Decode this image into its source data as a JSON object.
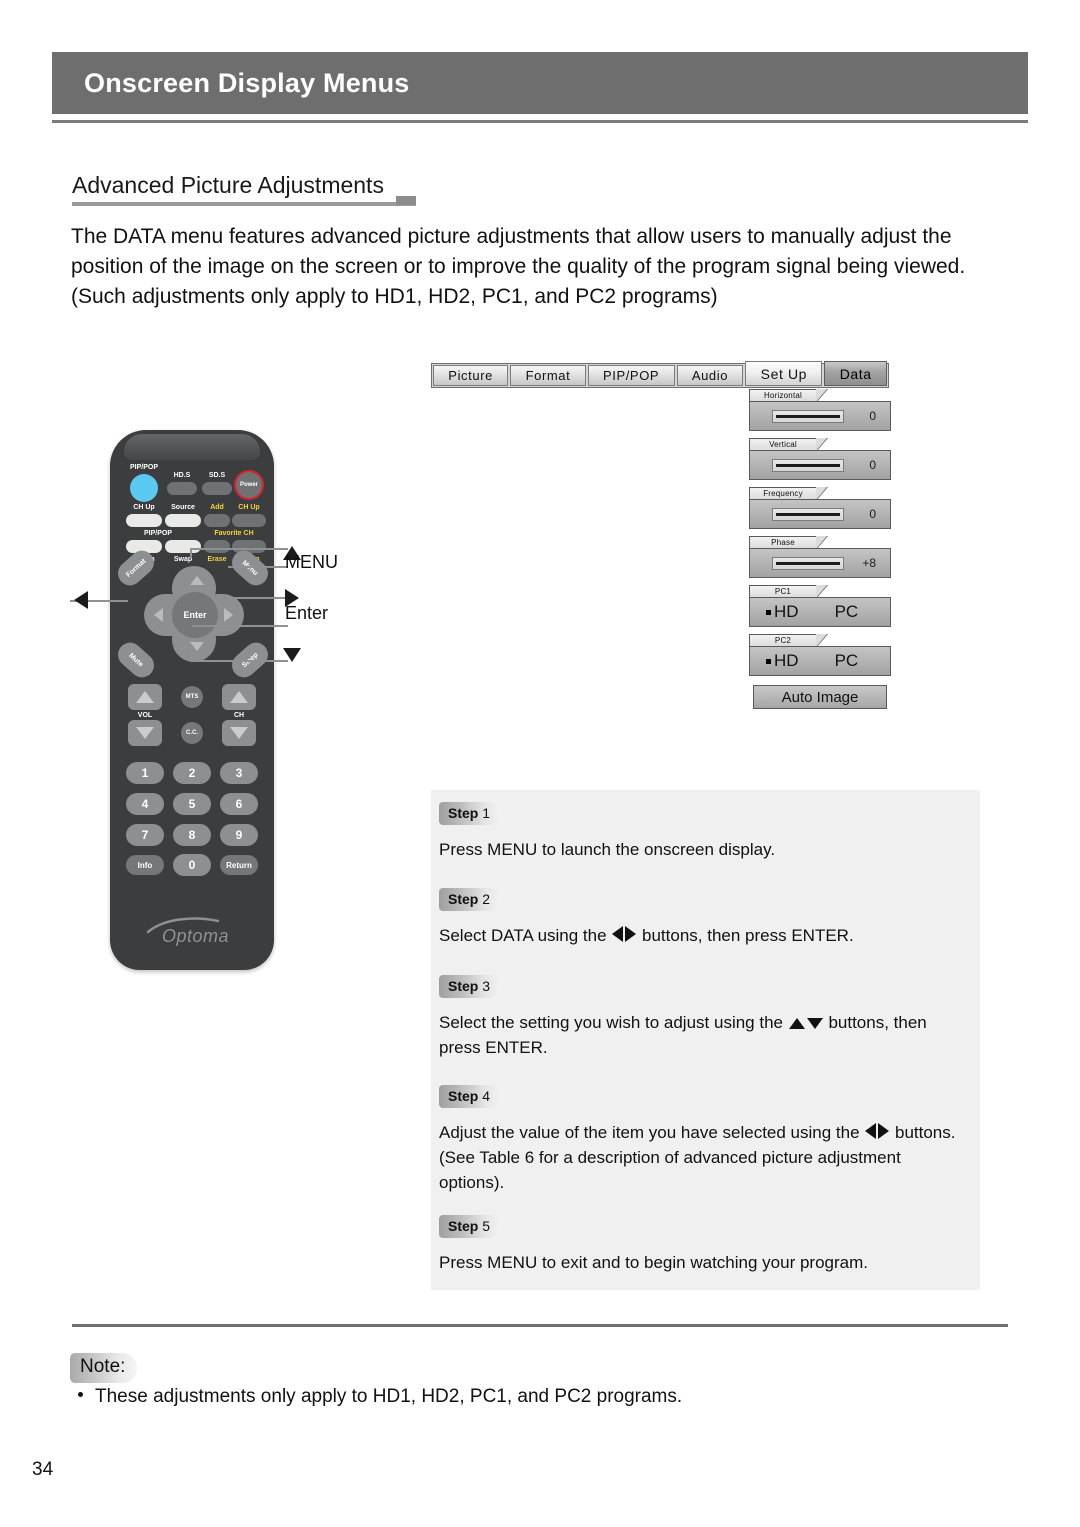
{
  "header": {
    "title": "Onscreen Display Menus"
  },
  "section": {
    "title": "Advanced Picture Adjustments",
    "intro": "The DATA menu features advanced picture adjustments that allow users to manually adjust the position of the image on the screen or to improve the quality of the program signal being viewed. (Such adjustments only apply to HD1, HD2, PC1, and PC2 programs)"
  },
  "osd": {
    "tabs": [
      {
        "label": "Picture",
        "state": "normal"
      },
      {
        "label": "Format",
        "state": "normal"
      },
      {
        "label": "PIP/POP",
        "state": "normal"
      },
      {
        "label": "Audio",
        "state": "normal"
      },
      {
        "label": "Set Up",
        "state": "tall"
      },
      {
        "label": "Data",
        "state": "selected"
      }
    ],
    "sliders": [
      {
        "label": "Horizontal",
        "value": "0"
      },
      {
        "label": "Vertical",
        "value": "0"
      },
      {
        "label": "Frequency",
        "value": "0"
      },
      {
        "label": "Phase",
        "value": "+8"
      }
    ],
    "choices": [
      {
        "label": "PC1",
        "option_a": "HD",
        "option_b": "PC",
        "selected": "HD"
      },
      {
        "label": "PC2",
        "option_a": "HD",
        "option_b": "PC",
        "selected": "HD"
      }
    ],
    "auto_image_label": "Auto Image"
  },
  "remote": {
    "labels": {
      "pip_pop_top": "PIP/POP",
      "hd_s": "HD.S",
      "sd_s": "SD.S",
      "power": "Power",
      "ch_up_left": "CH Up",
      "source": "Source",
      "add": "Add",
      "ch_up_right": "CH Up",
      "pip_pop_mid": "PIP/POP",
      "favorite_ch": "Favorite CH",
      "ch_dn_left": "CH Dn",
      "swap": "Swap",
      "erase": "Erase",
      "ch_dn_right": "CH Dn",
      "format": "Format",
      "menu": "Menu",
      "mute": "Mute",
      "sleep": "Sleep",
      "enter": "Enter",
      "vol": "VOL",
      "ch": "CH",
      "mts": "MTS",
      "cc": "C.C.",
      "info": "Info",
      "zero": "0",
      "return": "Return",
      "brand": "Optoma"
    },
    "numbers": [
      "1",
      "2",
      "3",
      "4",
      "5",
      "6",
      "7",
      "8",
      "9"
    ],
    "accent_colors": {
      "pip_pop_button": "#5bc8ef",
      "power_ring": "#d7232a",
      "yellow_label": "#f2d33c"
    }
  },
  "callouts": {
    "up": "▲",
    "menu": "MENU",
    "right": "▶",
    "enter": "Enter",
    "down": "▼",
    "left": "◀"
  },
  "steps": [
    {
      "pill_word": "Step",
      "pill_num": "1",
      "text_before": "Press MENU to launch the onscreen display.",
      "text_mid": "",
      "text_after": "",
      "glyphs": "none"
    },
    {
      "pill_word": "Step",
      "pill_num": "2",
      "text_before": "Select DATA  using the ",
      "text_mid": " buttons, then press ENTER.",
      "text_after": "",
      "glyphs": "lr"
    },
    {
      "pill_word": "Step",
      "pill_num": "3",
      "text_before": "Select the setting you wish to adjust  using the ",
      "text_mid": " buttons, then press ENTER.",
      "text_after": "",
      "glyphs": "ud"
    },
    {
      "pill_word": "Step",
      "pill_num": "4",
      "text_before": "Adjust the value of the item you have selected using the ",
      "text_mid": " buttons.  (See Table 6 for a description of advanced picture adjustment options).",
      "text_after": "",
      "glyphs": "lr"
    },
    {
      "pill_word": "Step",
      "pill_num": "5",
      "text_before": "Press MENU to exit and to begin watching your program.",
      "text_mid": "",
      "text_after": "",
      "glyphs": "none"
    }
  ],
  "note": {
    "label": "Note:",
    "bullet": "These adjustments only apply to HD1, HD2, PC1, and PC2 programs."
  },
  "page_number": "34"
}
